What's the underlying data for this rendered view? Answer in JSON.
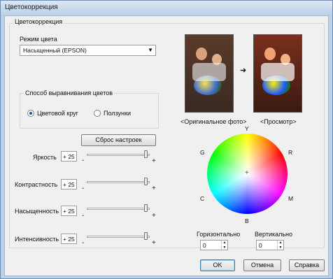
{
  "window": {
    "title": "Цветокоррекция"
  },
  "group": {
    "title": "Цветокоррекция"
  },
  "color_mode": {
    "label": "Режим цвета",
    "value": "Насыщенный (EPSON)"
  },
  "align_method": {
    "title": "Способ выравнивания цветов",
    "options": [
      {
        "label": "Цветовой круг",
        "checked": true
      },
      {
        "label": "Ползунки",
        "checked": false
      }
    ]
  },
  "reset_button": "Сброс настроек",
  "sliders": [
    {
      "label": "Яркость",
      "value": "+ 25",
      "minus": "-",
      "plus": "+"
    },
    {
      "label": "Контрастность",
      "value": "+ 25",
      "minus": "-",
      "plus": "+"
    },
    {
      "label": "Насыщенность",
      "value": "+ 25",
      "minus": "-",
      "plus": "+"
    },
    {
      "label": "Интенсивность",
      "value": "+ 25",
      "minus": "-",
      "plus": "+"
    }
  ],
  "preview": {
    "original_label": "<Оригинальное фото>",
    "preview_label": "<Просмотр>",
    "arrow": "➜"
  },
  "wheel": {
    "labels": {
      "Y": "Y",
      "R": "R",
      "M": "M",
      "B": "B",
      "C": "C",
      "G": "G"
    },
    "center": "+"
  },
  "horizontal": {
    "label": "Горизонтально",
    "value": "0"
  },
  "vertical": {
    "label": "Вертикально",
    "value": "0"
  },
  "buttons": {
    "ok": "OK",
    "cancel": "Отмена",
    "help": "Справка"
  }
}
